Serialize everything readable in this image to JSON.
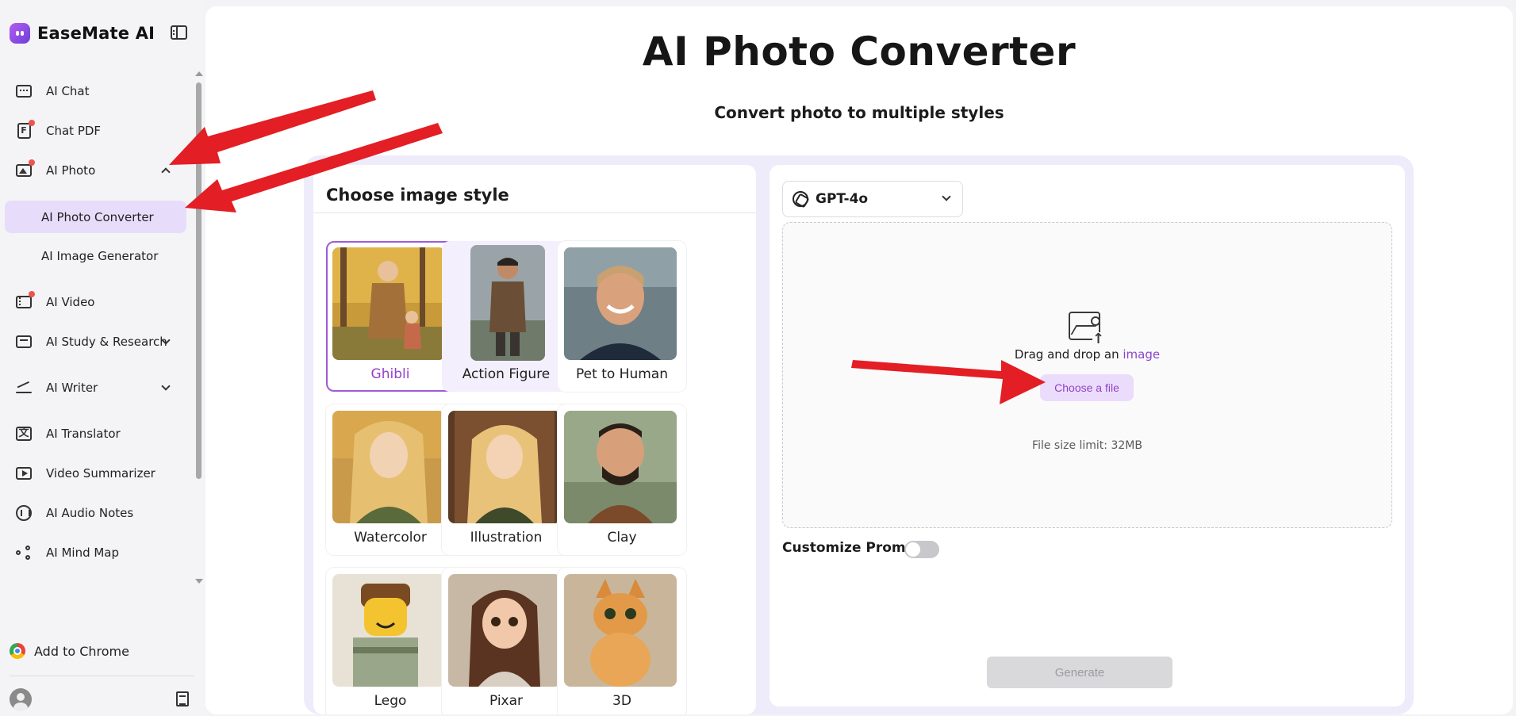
{
  "sidebar": {
    "brand": "EaseMate AI",
    "items": [
      {
        "label": "AI Chat"
      },
      {
        "label": "Chat PDF",
        "doc_letter": "F"
      },
      {
        "label": "AI Photo"
      },
      {
        "label": "AI Photo Converter"
      },
      {
        "label": "AI Image Generator"
      },
      {
        "label": "AI Video"
      },
      {
        "label": "AI Study & Research"
      },
      {
        "label": "AI Writer"
      },
      {
        "label": "AI Translator",
        "glyph": "文"
      },
      {
        "label": "Video Summarizer"
      },
      {
        "label": "AI Audio Notes"
      },
      {
        "label": "AI Mind Map"
      }
    ],
    "add_to_chrome": "Add to Chrome"
  },
  "main": {
    "title": "AI Photo Converter",
    "subtitle": "Convert photo to multiple styles",
    "styles_panel": {
      "title": "Choose image style",
      "styles": [
        {
          "name": "Ghibli",
          "selected": true
        },
        {
          "name": "Action Figure"
        },
        {
          "name": "Pet to Human"
        },
        {
          "name": "Watercolor"
        },
        {
          "name": "Illustration"
        },
        {
          "name": "Clay"
        },
        {
          "name": "Lego"
        },
        {
          "name": "Pixar"
        },
        {
          "name": "3D"
        }
      ]
    },
    "converter": {
      "model": "GPT-4o",
      "drag_text": "Drag and drop an",
      "drag_link": "image",
      "choose_file": "Choose a file",
      "file_limit": "File size limit: 32MB",
      "customize_prompt": "Customize Prompt",
      "generate": "Generate",
      "upload_arrow_glyph": "↑"
    }
  },
  "colors": {
    "accent": "#9340c8",
    "active_nav": "#e8dcfb",
    "panel_bg": "#eeebfb",
    "annotation": "#e31e24"
  }
}
